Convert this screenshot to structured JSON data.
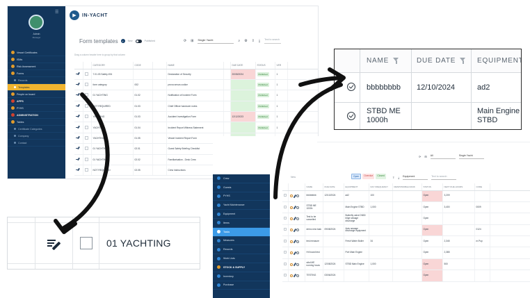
{
  "form_app": {
    "logo_letter": "▶",
    "logo_text": "IN-YACHT",
    "user_name": "Admin",
    "user_role": "Manager",
    "sidebar_items": [
      {
        "label": "Vessel Certificates",
        "type": "item"
      },
      {
        "label": "ISMs",
        "type": "item"
      },
      {
        "label": "Risk Assessment",
        "type": "item"
      },
      {
        "label": "Forms",
        "type": "item"
      },
      {
        "label": "Records",
        "type": "sub"
      },
      {
        "label": "Templates",
        "type": "active"
      },
      {
        "label": "People on board",
        "type": "item"
      },
      {
        "label": "APPS",
        "type": "section"
      },
      {
        "label": "PYHS",
        "type": "item"
      },
      {
        "label": "ADMINISTRATION",
        "type": "section"
      },
      {
        "label": "Tables",
        "type": "item"
      },
      {
        "label": "Certificate Categories",
        "type": "sub"
      },
      {
        "label": "Company",
        "type": "sub"
      },
      {
        "label": "Contact",
        "type": "sub"
      }
    ],
    "page_title": "Form templates",
    "new_label": "New",
    "published_label": "Published",
    "yacht_select": "Single Yacht",
    "search_placeholder": "Text to search",
    "group_hint": "Drag a column header here to group by that column",
    "columns": [
      "",
      "",
      "CATEGORY",
      "CODE",
      "",
      "NAME",
      "",
      "DUE DATE",
      "STATUS",
      "VER",
      ""
    ],
    "rows": [
      {
        "category": "7.01.03 Safety 494",
        "code": "",
        "name": "Declaration of Security",
        "due": "20/08/2024",
        "due_state": "red",
        "status": "Published",
        "ver": "1"
      },
      {
        "category": "form category",
        "code": "002",
        "name": "prova senza codice",
        "due": "",
        "due_state": "green",
        "status": "Published",
        "ver": "1"
      },
      {
        "category": "01 YACHTING",
        "code": "01.02",
        "name": "Notification of Incident Form",
        "due": "",
        "due_state": "green",
        "status": "Published",
        "ver": "1"
      },
      {
        "category": "NOT REQUIRED",
        "code": "01.03",
        "name": "Chief Officer handover notes",
        "due": "",
        "due_state": "green",
        "status": "Published",
        "ver": "1"
      },
      {
        "category": "YACHTING",
        "code": "01.03",
        "name": "Accident Investigation Form",
        "due": "12/12/2023",
        "due_state": "red",
        "status": "Published",
        "ver": "1"
      },
      {
        "category": "YACHTING",
        "code": "01.04",
        "name": "Incident Report Witness Statement",
        "due": "",
        "due_state": "green",
        "status": "Published",
        "ver": "1"
      },
      {
        "category": "YACHTING",
        "code": "01.05",
        "name": "Vessel Incident Report Form",
        "due": "",
        "due_state": "green",
        "status": "Published",
        "ver": "1"
      },
      {
        "category": "01 YACHTING",
        "code": "02.01",
        "name": "Guest Safety Briefing Checklist",
        "due": "20/10/2024",
        "due_state": "red",
        "status": "Published",
        "ver": "1"
      },
      {
        "category": "01 YACHTING",
        "code": "02.02",
        "name": "Familiarisation - Deck Crew",
        "due": "20/10/2023",
        "due_state": "red",
        "status": "Published",
        "ver": "1"
      },
      {
        "category": "NOT REQUIRED",
        "code": "02.05",
        "name": "Crew instructions",
        "due": "06/12/2023",
        "due_state": "red",
        "status": "Published",
        "ver": "1"
      }
    ]
  },
  "zoom_row": {
    "category": "01 YACHTING"
  },
  "zoom_cols": {
    "headers": {
      "name": "NAME",
      "due_date": "DUE DATE",
      "equipment": "EQUIPMENT"
    },
    "rows": [
      {
        "name": "bbbbbbbb",
        "due_date": "12/10/2024",
        "equipment": "ad2"
      },
      {
        "name": "STBD ME 1000h",
        "due_date": "",
        "equipment": "Main Engine STBD"
      }
    ]
  },
  "maint_app": {
    "sidebar_items": [
      {
        "label": "Crew",
        "type": "item"
      },
      {
        "label": "Guests",
        "type": "item"
      },
      {
        "label": "PYHS",
        "type": "item"
      },
      {
        "label": "Yacht Maintenance",
        "type": "item"
      },
      {
        "label": "Equipment",
        "type": "item"
      },
      {
        "label": "Items",
        "type": "item"
      },
      {
        "label": "Tasks",
        "type": "active"
      },
      {
        "label": "Measures",
        "type": "item"
      },
      {
        "label": "Records",
        "type": "item"
      },
      {
        "label": "Work Lists",
        "type": "item"
      },
      {
        "label": "STOCK & SUPPLY",
        "type": "section"
      },
      {
        "label": "Inventory",
        "type": "item"
      },
      {
        "label": "Purchase",
        "type": "item"
      }
    ],
    "filter_all": "All",
    "yacht_select": "Single Yacht",
    "equipment_label": "Equipment",
    "search_placeholder": "Text to search",
    "new_label": "New",
    "status_tabs": {
      "open": "Open",
      "overdue": "Overdue",
      "closed": "Closed"
    },
    "columns": [
      "",
      "",
      "NAME",
      "DUE DATE",
      "EQUIPMENT",
      "DAY FREQUENCY",
      "RESPONSIBLE RANK",
      "STATUS",
      "NEXT DUE HOURS",
      "CODE",
      ""
    ],
    "rows": [
      {
        "name": "bbbbbbbb",
        "due": "12/10/2024",
        "equipment": "ad2",
        "freq": "100",
        "rank": "",
        "status": "Open",
        "hours": "3,209",
        "code": "",
        "due_state": "red"
      },
      {
        "name": "STBD ME 1000h",
        "due": "",
        "equipment": "Main Engine STBD",
        "freq": "1,000",
        "rank": "",
        "status": "Open",
        "hours": "3,400",
        "code": "0009",
        "due_state": "none"
      },
      {
        "name": "Test to be cancelled",
        "due": "",
        "equipment": "Butterfly valve DN50 bilge sewage discharge",
        "freq": "",
        "rank": "",
        "status": "Open",
        "hours": "",
        "code": "",
        "due_state": "none"
      },
      {
        "name": "demo new task",
        "due": "09/08/2024",
        "equipment": "Auto sewage discharge equipment",
        "freq": "",
        "rank": "",
        "status": "Open",
        "hours": "",
        "code": "0124",
        "due_state": "red"
      },
      {
        "name": "test measure",
        "due": "",
        "equipment": "Fresh Water Boiler",
        "freq": "34",
        "rank": "",
        "status": "Open",
        "hours": "2,345",
        "code": "m.Pop",
        "due_state": "none"
      },
      {
        "name": "Hrl board test",
        "due": "",
        "equipment": "Port Main Engine",
        "freq": "",
        "rank": "",
        "status": "Open",
        "hours": "2,385",
        "code": "",
        "due_state": "none"
      },
      {
        "name": "stbd ME running hours",
        "due": "12/08/2024",
        "equipment": "STBD Main Engine",
        "freq": "1,000",
        "rank": "",
        "status": "Open",
        "hours": "500",
        "code": "",
        "due_state": "red"
      },
      {
        "name": "TESTING",
        "due": "03/06/2024",
        "equipment": "",
        "freq": "",
        "rank": "",
        "status": "Open",
        "hours": "",
        "code": "",
        "due_state": "red"
      }
    ]
  }
}
